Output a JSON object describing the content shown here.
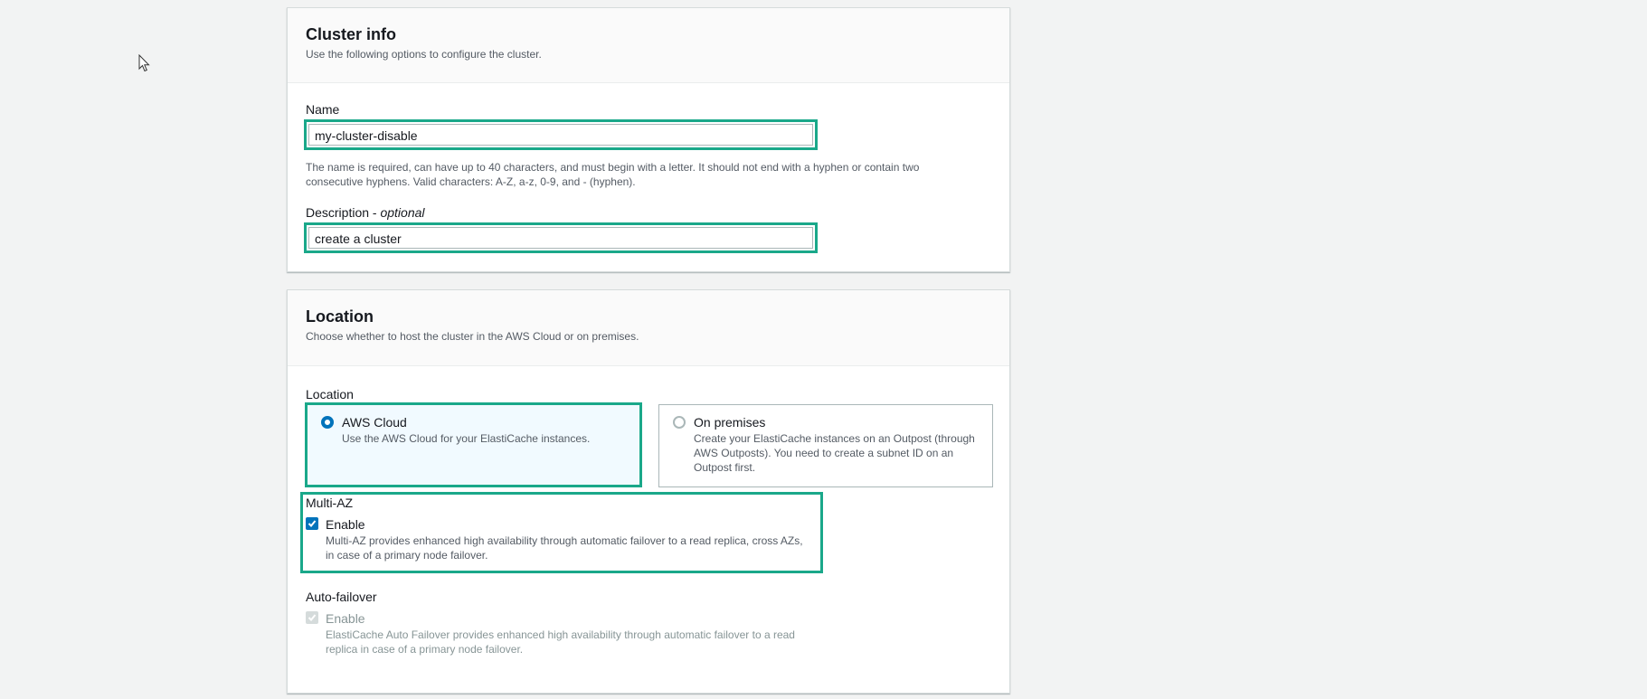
{
  "cluster_info": {
    "title": "Cluster info",
    "description": "Use the following options to configure the cluster.",
    "name_label": "Name",
    "name_value": "my-cluster-disable",
    "name_hint_line1": "The name is required, can have up to 40 characters, and must begin with a letter. It should not end with a hyphen or contain two",
    "name_hint_line2": "consecutive hyphens. Valid characters: A-Z, a-z, 0-9, and - (hyphen).",
    "description_label": "Description - ",
    "description_optional": "optional",
    "description_value": "create a cluster"
  },
  "location": {
    "title": "Location",
    "description": "Choose whether to host the cluster in the AWS Cloud or on premises.",
    "field_label": "Location",
    "options": [
      {
        "title": "AWS Cloud",
        "description": "Use the AWS Cloud for your ElastiCache instances.",
        "selected": true
      },
      {
        "title": "On premises",
        "description_line1": "Create your ElastiCache instances on an Outpost (through",
        "description_line2": "AWS Outposts). You need to create a subnet ID on an",
        "description_line3": "Outpost first.",
        "selected": false
      }
    ],
    "multi_az": {
      "label": "Multi-AZ",
      "checkbox_label": "Enable",
      "checked": true,
      "description_line1": "Multi-AZ provides enhanced high availability through automatic failover to a read replica, cross AZs,",
      "description_line2": "in case of a primary node failover."
    },
    "auto_failover": {
      "label": "Auto-failover",
      "checkbox_label": "Enable",
      "checked": true,
      "disabled": true,
      "description_line1": "ElastiCache Auto Failover provides enhanced high availability through automatic failover to a read",
      "description_line2": "replica in case of a primary node failover."
    }
  },
  "colors": {
    "highlight": "#1aa88a",
    "accent": "#0073bb",
    "background": "#f2f3f3"
  },
  "icons": {
    "cursor": "mouse-pointer-icon",
    "check": "checkmark-icon"
  }
}
